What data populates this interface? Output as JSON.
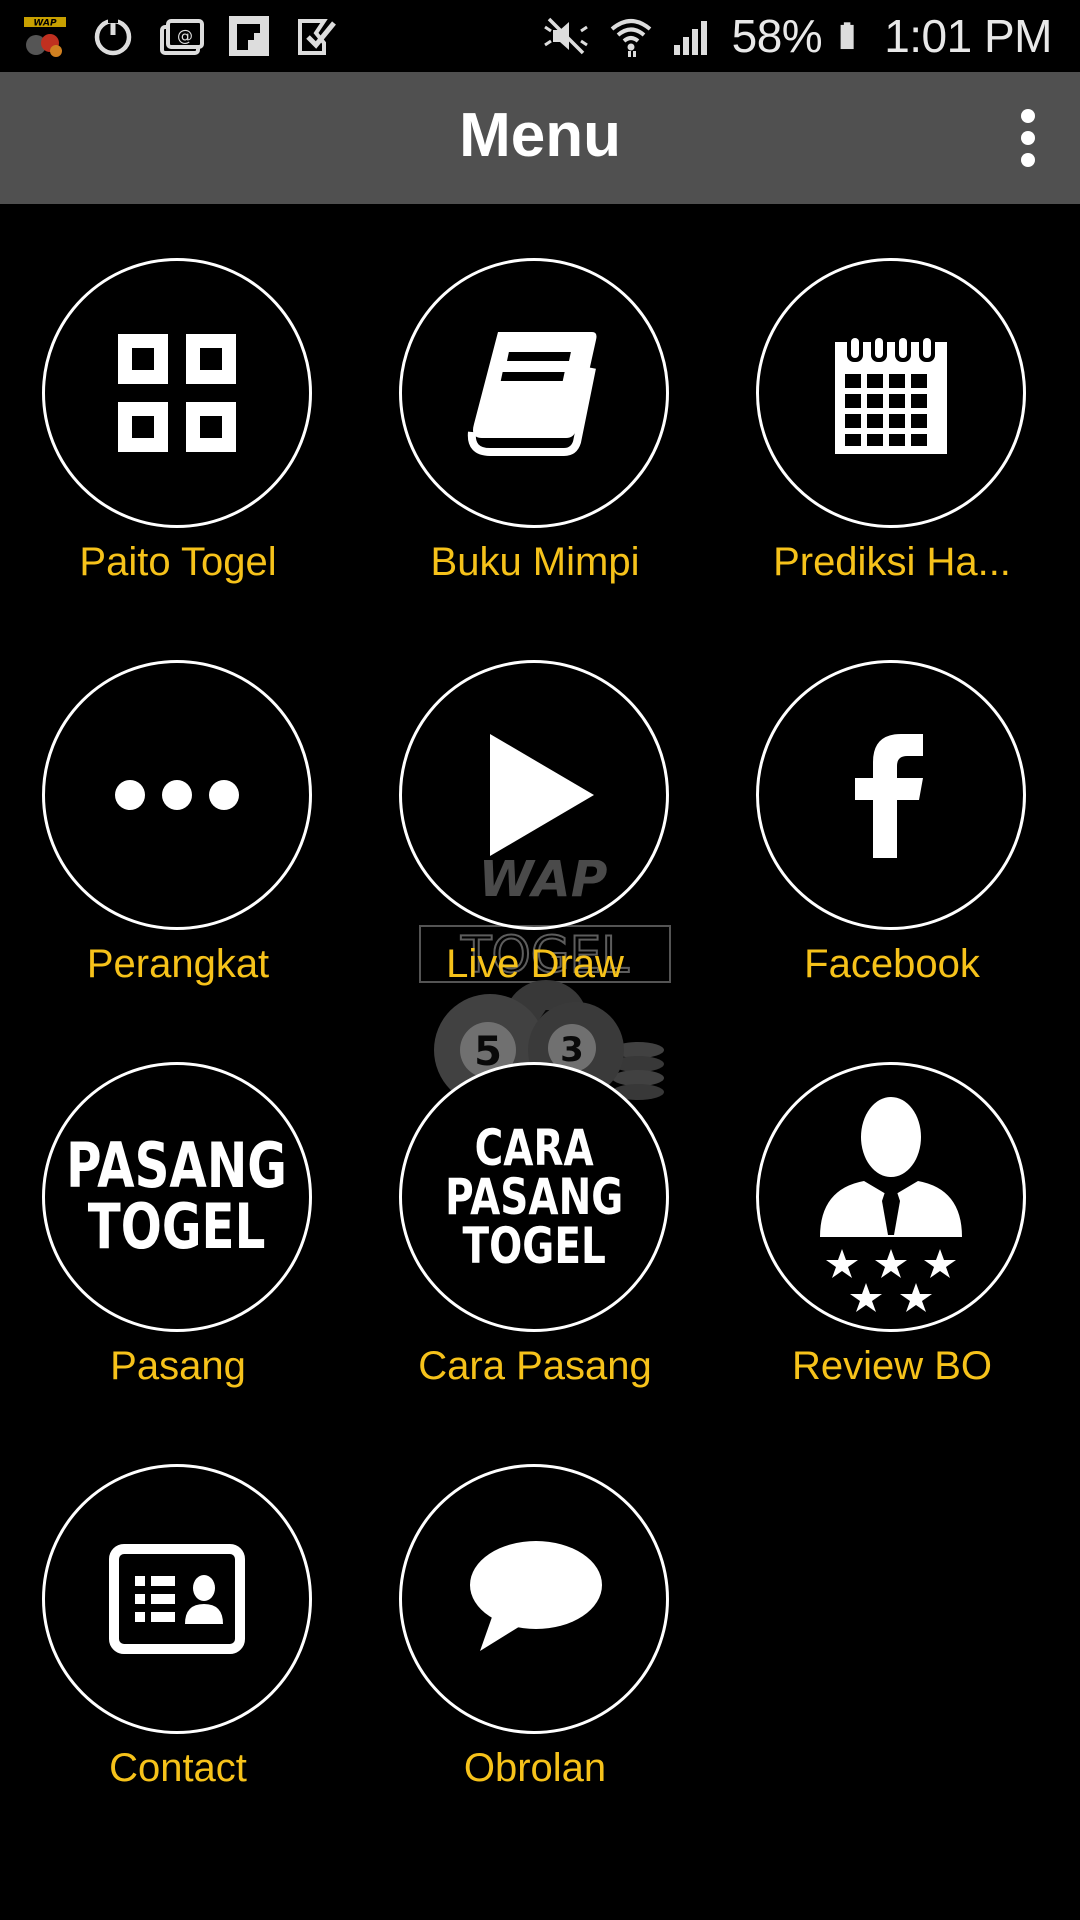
{
  "status_bar": {
    "battery_percent": "58%",
    "time": "1:01 PM",
    "icons": [
      "wap-togel-app-icon",
      "sync-icon",
      "mail-icon",
      "flipboard-icon",
      "task-icon",
      "mute-icon",
      "wifi-icon",
      "signal-icon",
      "battery-icon"
    ]
  },
  "toolbar": {
    "title": "Menu",
    "overflow_icon": "more-vert-icon"
  },
  "watermark": {
    "line1": "WAP",
    "line2": "TOGEL",
    "ball_left": "5",
    "ball_right": "3",
    "ball_back": "4"
  },
  "menu": {
    "items": [
      {
        "label": "Paito Togel",
        "icon": "grid-icon"
      },
      {
        "label": "Buku Mimpi",
        "icon": "book-icon"
      },
      {
        "label": "Prediksi Ha...",
        "icon": "calendar-icon"
      },
      {
        "label": "Perangkat",
        "icon": "more-horiz-icon"
      },
      {
        "label": "Live Draw",
        "icon": "play-icon"
      },
      {
        "label": "Facebook",
        "icon": "facebook-icon"
      },
      {
        "label": "Pasang",
        "icon": "pasang-togel-icon",
        "icon_text": [
          "PASANG",
          "TOGEL"
        ]
      },
      {
        "label": "Cara Pasang",
        "icon": "cara-pasang-togel-icon",
        "icon_text": [
          "CARA",
          "PASANG",
          "TOGEL"
        ]
      },
      {
        "label": "Review BO",
        "icon": "person-stars-icon"
      },
      {
        "label": "Contact",
        "icon": "contact-card-icon"
      },
      {
        "label": "Obrolan",
        "icon": "chat-bubble-icon"
      }
    ]
  },
  "colors": {
    "background": "#000000",
    "toolbar": "#505050",
    "label": "#f6c21a",
    "icon": "#ffffff"
  }
}
